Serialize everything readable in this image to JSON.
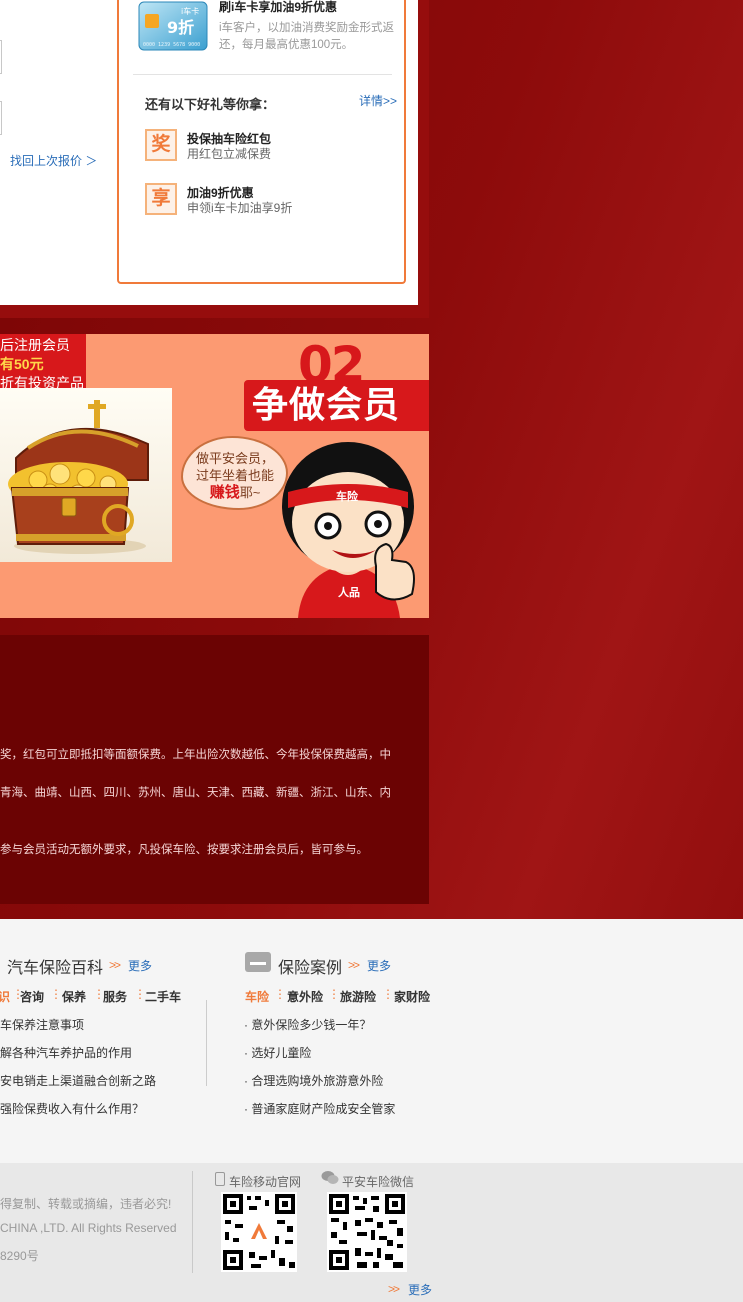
{
  "quote_panel": {
    "last_quote_link": "找回上次报价 ＞"
  },
  "gift_box": {
    "card_title": "刷i车卡享加油9折优惠",
    "card_desc": "i车客户，以加油消费奖励金形式返还，每月最高优惠100元。",
    "card_image": {
      "brand": "i车卡",
      "discount": "9折",
      "number": "0000 1239 5678 9000"
    },
    "more_heading": "还有以下好礼等你拿：",
    "details_link": "详情>>",
    "gifts": [
      {
        "icon": "奖",
        "title": "投保抽车险红包",
        "subtitle": "用红包立减保费"
      },
      {
        "icon": "享",
        "title": "加油9折优惠",
        "subtitle": "申领i车卡加油享9折"
      }
    ]
  },
  "banner": {
    "tag_lines": [
      "后注册会员",
      "有50元",
      "折有投资产品"
    ],
    "number": "02",
    "title": "争做会员",
    "bubble_line1": "做平安会员，",
    "bubble_line2": "过年坐着也能",
    "bubble_emph": "赚钱",
    "bubble_tail": "耶~",
    "headband_text": "车险",
    "shirt_text": "人品"
  },
  "info": {
    "lines": [
      "奖，红包可立即抵扣等面额保费。上年出险次数越低、今年投保保费越高，中",
      "青海、曲靖、山西、四川、苏州、唐山、天津、西藏、新疆、浙江、山东、内",
      "参与会员活动无额外要求，凡投保车险、按要求注册会员后，皆可参与。"
    ]
  },
  "encyclopedia": {
    "title": "汽车保险百科",
    "more": "更多",
    "more_arrow": ">>",
    "cut_cat": "识",
    "cats": [
      "咨询",
      "保养",
      "服务",
      "二手车"
    ],
    "items": [
      "车保养注意事项",
      "解各种汽车养护品的作用",
      "安电销走上渠道融合创新之路",
      "强险保费收入有什么作用？"
    ]
  },
  "cases": {
    "title": "保险案例",
    "more": "更多",
    "more_arrow": ">>",
    "cats": [
      "车险",
      "意外险",
      "旅游险",
      "家财险"
    ],
    "items": [
      "· 意外保险多少钱一年？",
      "· 选好儿童险",
      "· 合理选购境外旅游意外险",
      "· 普通家庭财产险成安全管家"
    ]
  },
  "footer": {
    "lines": [
      "得复制、转载或摘编，违者必究!",
      "CHINA ,LTD. All Rights Reserved",
      "8290号"
    ],
    "mobile_label": "车险移动官网",
    "wechat_label": "平安车险微信",
    "more": "更多",
    "more_arrow": ">>"
  },
  "colors": {
    "page_red": "#8d0b0b",
    "accent_orange": "#f07a3a",
    "brand_red": "#d7181b",
    "link_blue": "#2a6db8",
    "banner_peach": "#fc9a72",
    "info_dark_red": "#6b0303"
  }
}
